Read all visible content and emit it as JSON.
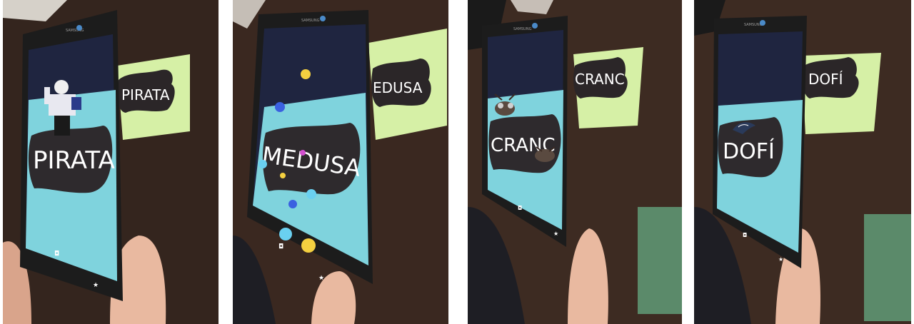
{
  "brand": "SAMSUNG",
  "photos": [
    {
      "word": "PIRATA",
      "card_word": "PIRATA",
      "character": "pirate"
    },
    {
      "word": "MEDUSA",
      "card_word": "EDUSA",
      "character": "jellyfish"
    },
    {
      "word": "CRANC",
      "card_word": "CRANC",
      "character": "crab"
    },
    {
      "word": "DOFÍ",
      "card_word": "DOFÍ",
      "character": "dolphin"
    }
  ],
  "colors": {
    "table": "#3b2a22",
    "tablet_bezel": "#1c1c1c",
    "screen_top": "#1f2540",
    "screen_sky": "#7fd3dd",
    "blob": "#2e2a2d",
    "card": "#d6f0a6",
    "skin": "#e9b9a0"
  }
}
